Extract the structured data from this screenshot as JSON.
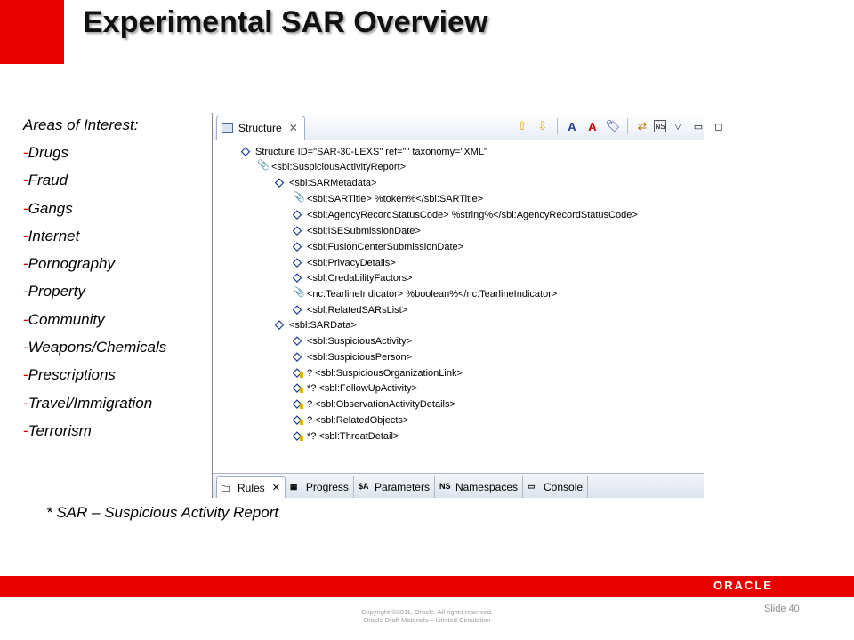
{
  "slide": {
    "title": "Experimental SAR Overview",
    "areas_heading": "Areas of Interest:",
    "areas": [
      "Drugs",
      "Fraud",
      "Gangs",
      "Internet",
      "Pornography",
      "Property",
      "Community",
      "Weapons/Chemicals",
      "Prescriptions",
      "Travel/Immigration",
      "Terrorism"
    ],
    "footnote": "* SAR – Suspicious Activity Report",
    "brand": "ORACLE",
    "copyright_line1": "Copyright ©2011, Oracle. All rights reserved.",
    "copyright_line2": "Oracle Draft Materials – Limited Circulation",
    "slide_number": "Slide 40"
  },
  "eclipse": {
    "tab_label": "Structure",
    "toolbar_icons": [
      "up-arrow-icon",
      "down-arrow-icon",
      "add-attribute-icon",
      "delete-attribute-icon",
      "move-icon",
      "namespace-icon",
      "view-menu-icon",
      "minimize-icon",
      "maximize-icon"
    ],
    "tree": [
      {
        "icon": "el",
        "opt": false,
        "text": "Structure ID=\"SAR-30-LEXS\" ref=\"\" taxonomy=\"XML\""
      },
      {
        "icon": "clip",
        "opt": false,
        "text": "<sbl:SuspiciousActivityReport>"
      },
      {
        "icon": "el",
        "opt": false,
        "text": "<sbl:SARMetadata>"
      },
      {
        "icon": "clip",
        "opt": false,
        "text": "<sbl:SARTitle> %token%</sbl:SARTitle>"
      },
      {
        "icon": "el",
        "opt": false,
        "text": "<sbl:AgencyRecordStatusCode> %string%</sbl:AgencyRecordStatusCode>"
      },
      {
        "icon": "el",
        "opt": false,
        "text": "<sbl:ISESubmissionDate>"
      },
      {
        "icon": "el",
        "opt": false,
        "text": "<sbl:FusionCenterSubmissionDate>"
      },
      {
        "icon": "el",
        "opt": false,
        "text": "<sbl:PrivacyDetails>"
      },
      {
        "icon": "el",
        "opt": false,
        "text": "<sbl:CredabilityFactors>"
      },
      {
        "icon": "clip",
        "opt": false,
        "text": "<nc:TearlineIndicator> %boolean%</nc:TearlineIndicator>"
      },
      {
        "icon": "el",
        "opt": false,
        "text": "<sbl:RelatedSARsList>"
      },
      {
        "icon": "el",
        "opt": false,
        "text": "<sbl:SARData>"
      },
      {
        "icon": "el",
        "opt": false,
        "text": "<sbl:SuspiciousActivity>"
      },
      {
        "icon": "el",
        "opt": false,
        "text": "<sbl:SuspiciousPerson>"
      },
      {
        "icon": "el",
        "opt": true,
        "text": "? <sbl:SuspiciousOrganizationLink>"
      },
      {
        "icon": "el",
        "opt": true,
        "text": "*? <sbl:FollowUpActivity>"
      },
      {
        "icon": "el",
        "opt": true,
        "text": "? <sbl:ObservationActivityDetails>"
      },
      {
        "icon": "el",
        "opt": true,
        "text": "? <sbl:RelatedObjects>"
      },
      {
        "icon": "el",
        "opt": true,
        "text": "*? <sbl:ThreatDetail>"
      }
    ],
    "bottom_tabs": [
      {
        "label": "Rules",
        "icon": "folder-icon",
        "closable": true,
        "active": true
      },
      {
        "label": "Progress",
        "icon": "progress-icon",
        "closable": false,
        "active": false
      },
      {
        "label": "Parameters",
        "icon": "parameters-icon",
        "closable": false,
        "active": false
      },
      {
        "label": "Namespaces",
        "icon": "namespaces-icon",
        "closable": false,
        "active": false
      },
      {
        "label": "Console",
        "icon": "console-icon",
        "closable": false,
        "active": false
      }
    ]
  }
}
